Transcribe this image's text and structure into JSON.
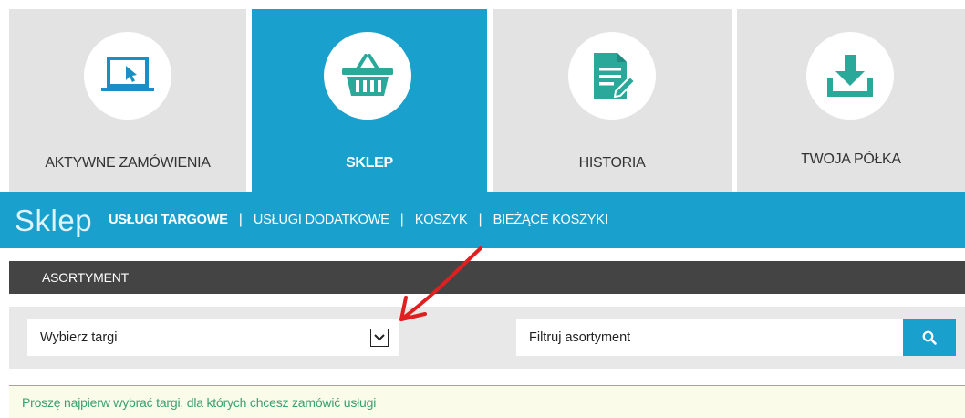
{
  "tabs": [
    {
      "label": "AKTYWNE ZAMÓWIENIA",
      "icon": "laptop-cursor-icon",
      "active": false
    },
    {
      "label": "SKLEP",
      "icon": "basket-icon",
      "active": true
    },
    {
      "label": "HISTORIA",
      "icon": "document-edit-icon",
      "active": false
    },
    {
      "label": "TWOJA PÓŁKA",
      "icon": "download-icon",
      "active": false
    }
  ],
  "subnav": {
    "title": "Sklep",
    "links": [
      "USŁUGI TARGOWE",
      "USŁUGI DODATKOWE",
      "KOSZYK",
      "BIEŻĄCE KOSZYKI"
    ],
    "separator": "|"
  },
  "section": {
    "title": "ASORTYMENT"
  },
  "filters": {
    "fair_select_value": "Wybierz targi",
    "search_placeholder": "Filtruj asortyment"
  },
  "notice": {
    "text": "Proszę najpierw wybrać targi, dla których chcesz zamówić usługi"
  },
  "colors": {
    "accent": "#1aa0cc",
    "tab_bg": "#e3e3e3",
    "icon_color": "#1aa0cc",
    "active_icon_color": "#2aa89a",
    "section_bar": "#444444",
    "notice_text": "#3aa070",
    "annotation": "#e02020"
  }
}
